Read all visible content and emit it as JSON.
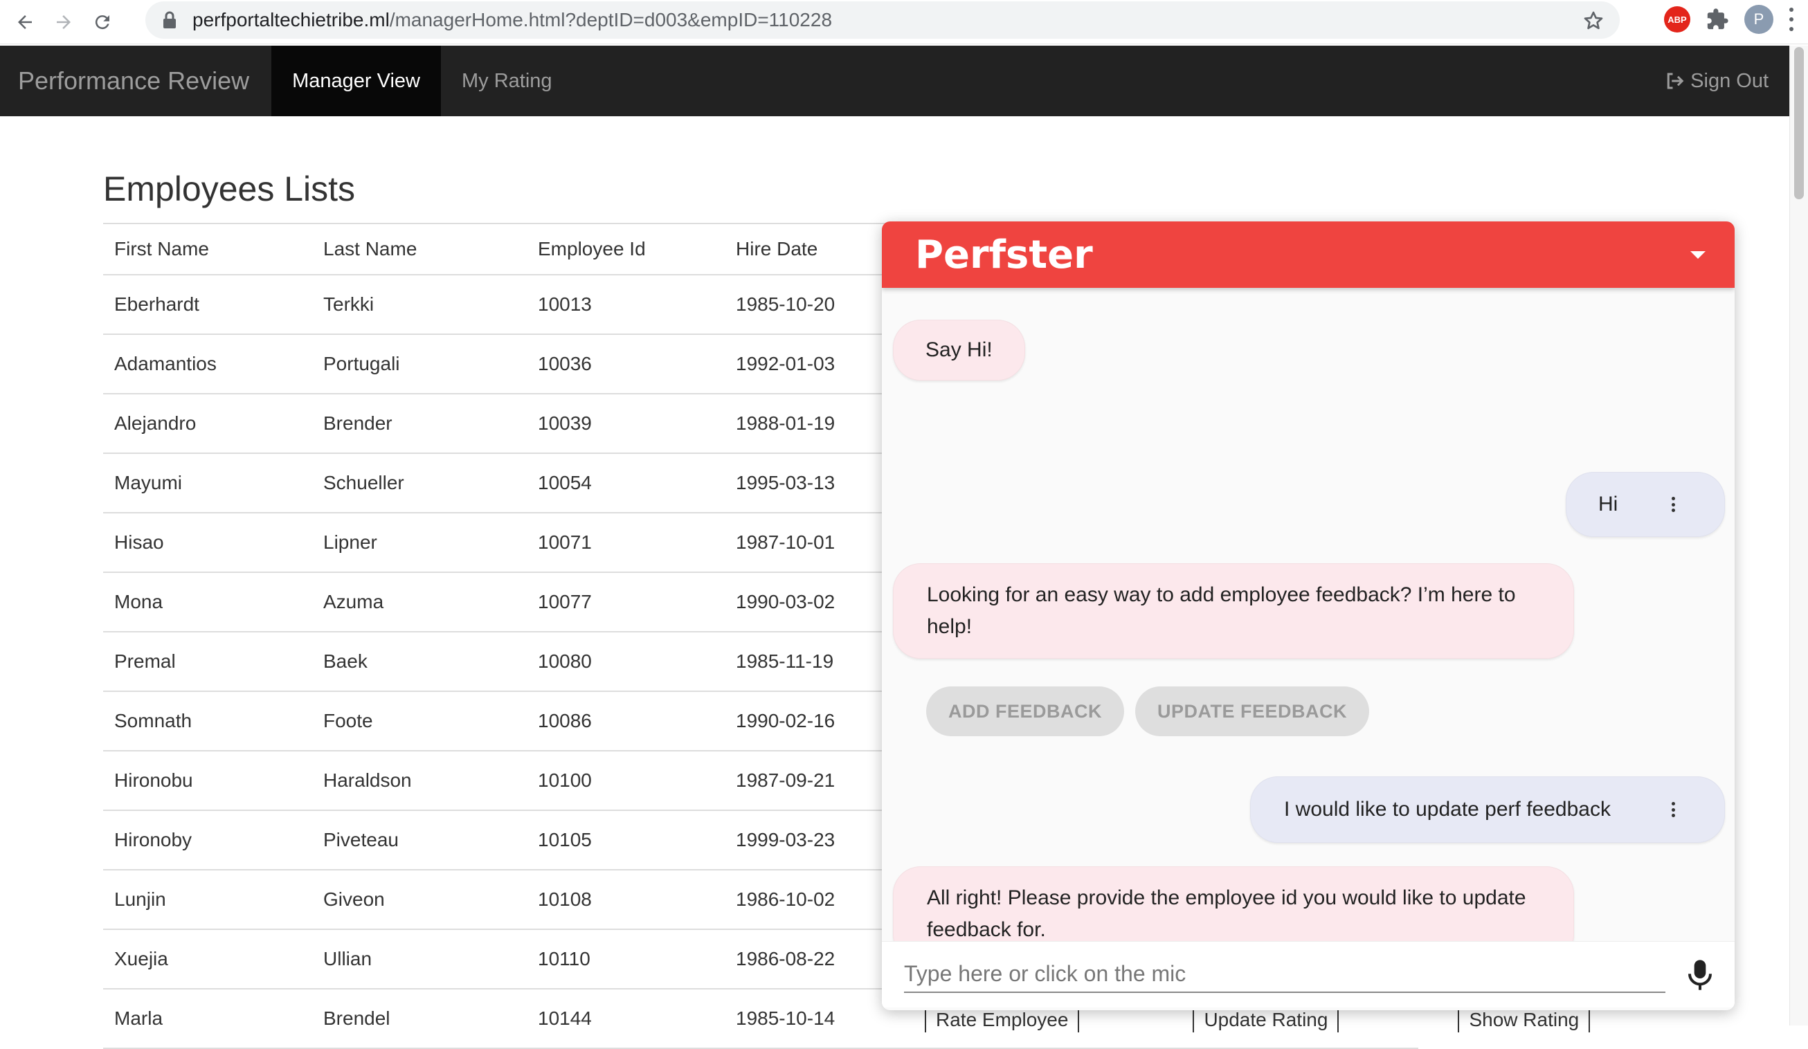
{
  "browser": {
    "url_host": "perfportaltechietribe.ml",
    "url_path": "/managerHome.html?deptID=d003&empID=110228",
    "abp_label": "ABP",
    "profile_initial": "P"
  },
  "navbar": {
    "brand": "Performance Review",
    "items": [
      {
        "label": "Manager View",
        "active": true
      },
      {
        "label": "My Rating",
        "active": false
      }
    ],
    "signout": "Sign Out"
  },
  "main": {
    "title": "Employees Lists",
    "columns": [
      "First Name",
      "Last Name",
      "Employee Id",
      "Hire Date"
    ],
    "rows": [
      [
        "Eberhardt",
        "Terkki",
        "10013",
        "1985-10-20"
      ],
      [
        "Adamantios",
        "Portugali",
        "10036",
        "1992-01-03"
      ],
      [
        "Alejandro",
        "Brender",
        "10039",
        "1988-01-19"
      ],
      [
        "Mayumi",
        "Schueller",
        "10054",
        "1995-03-13"
      ],
      [
        "Hisao",
        "Lipner",
        "10071",
        "1987-10-01"
      ],
      [
        "Mona",
        "Azuma",
        "10077",
        "1990-03-02"
      ],
      [
        "Premal",
        "Baek",
        "10080",
        "1985-11-19"
      ],
      [
        "Somnath",
        "Foote",
        "10086",
        "1990-02-16"
      ],
      [
        "Hironobu",
        "Haraldson",
        "10100",
        "1987-09-21"
      ],
      [
        "Hironoby",
        "Piveteau",
        "10105",
        "1999-03-23"
      ],
      [
        "Lunjin",
        "Giveon",
        "10108",
        "1986-10-02"
      ],
      [
        "Xuejia",
        "Ullian",
        "10110",
        "1986-08-22"
      ],
      [
        "Marla",
        "Brendel",
        "10144",
        "1985-10-14"
      ]
    ],
    "actions": [
      "Rate Employee",
      "Update Rating",
      "Show Rating"
    ]
  },
  "chat": {
    "title": "Perfster",
    "messages": {
      "m1": "Say Hi!",
      "m2": "Hi",
      "m3": "Looking for an easy way to add employee feedback? I’m here to help!",
      "m4": "I would like to update perf feedback",
      "m5": "All right! Please provide the employee id you would like to update feedback for."
    },
    "chips": [
      "ADD FEEDBACK",
      "UPDATE FEEDBACK"
    ],
    "input_placeholder": "Type here or click on the mic",
    "colors": {
      "header": "#ef4440",
      "bot_bubble": "#fce8ec",
      "user_bubble": "#e7e9f5"
    }
  }
}
